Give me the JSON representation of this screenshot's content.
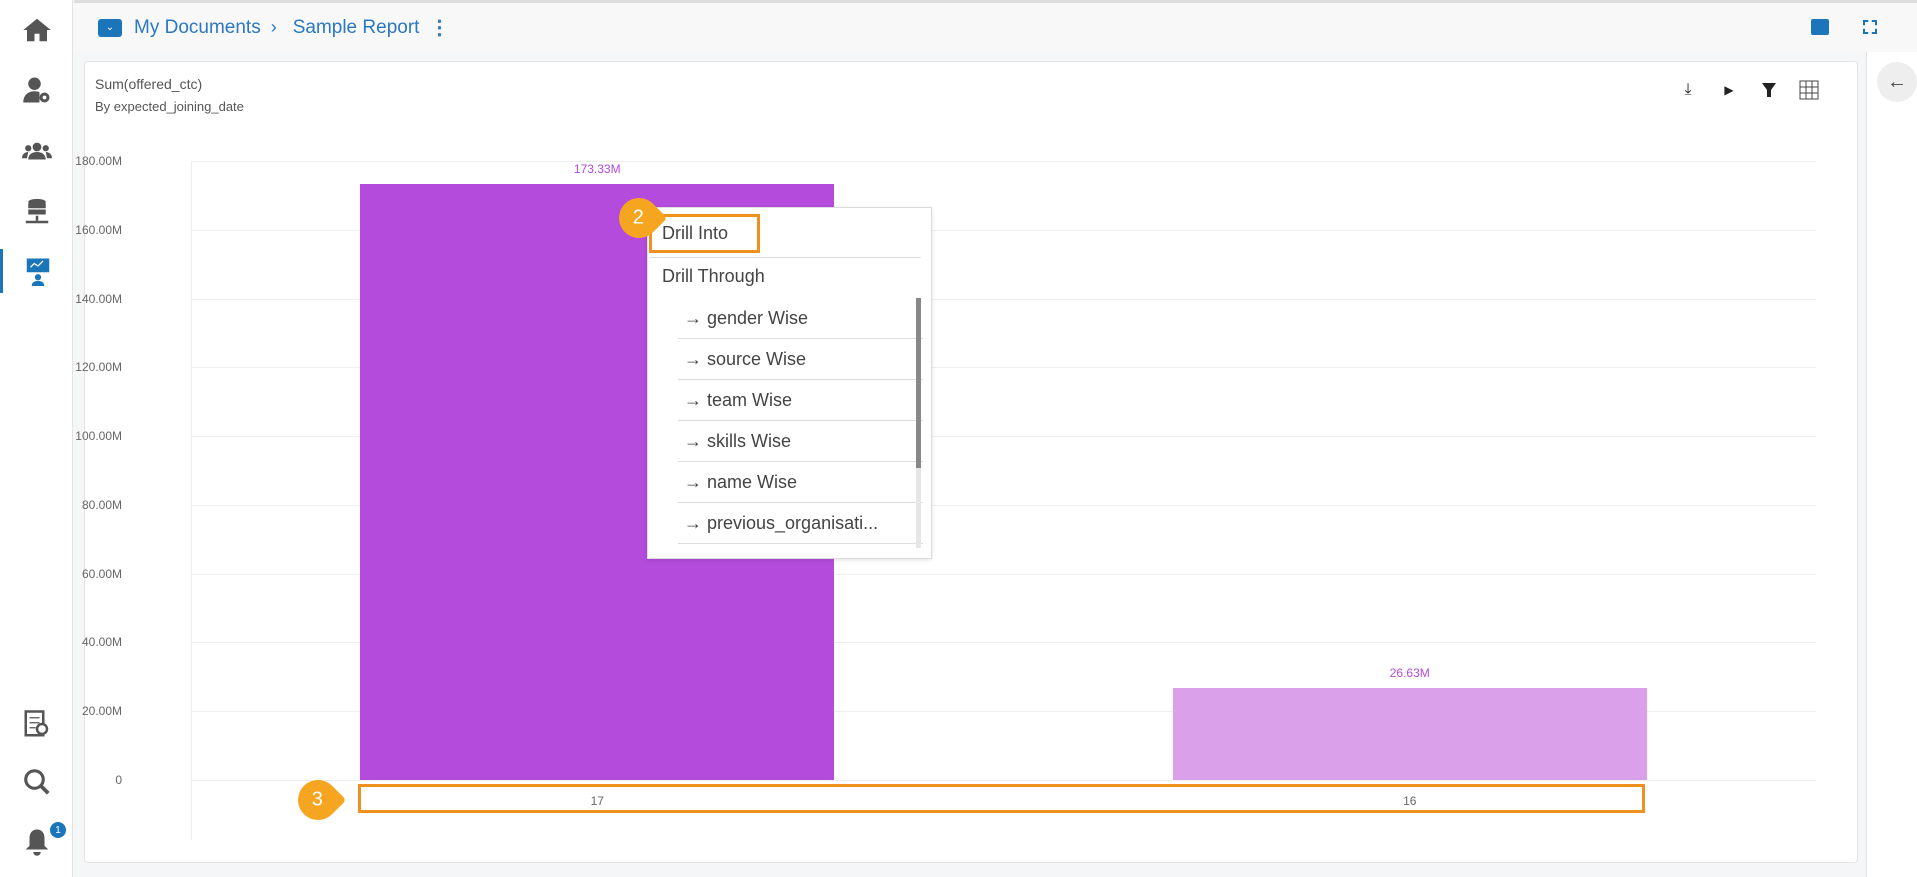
{
  "header": {
    "breadcrumb": [
      "My Documents",
      "Sample Report"
    ]
  },
  "chart_card": {
    "title": "Sum(offered_ctc)",
    "subtitle": "By expected_joining_date"
  },
  "notifications": {
    "count": "1"
  },
  "menu": {
    "drill_into": "Drill Into",
    "drill_through": "Drill Through",
    "items": [
      "→ gender Wise",
      "→ source Wise",
      "→ team Wise",
      "→ skills Wise",
      "→ name Wise",
      "→ previous_organisati..."
    ]
  },
  "annotations": {
    "menu_step": "2",
    "axis_step": "3"
  },
  "colors": {
    "bar_primary": "#b44bdc",
    "bar_secondary": "#dba0ea",
    "accent": "#1b75bb",
    "highlight": "#f0901e"
  },
  "chart_data": {
    "type": "bar",
    "title": "Sum(offered_ctc)",
    "subtitle": "By expected_joining_date",
    "categories": [
      "17",
      "16"
    ],
    "values": [
      173.33,
      26.63
    ],
    "value_labels": [
      "173.33M",
      "26.63M"
    ],
    "ylim": [
      0,
      180
    ],
    "yticks": [
      "0",
      "20.00M",
      "40.00M",
      "60.00M",
      "80.00M",
      "100.00M",
      "120.00M",
      "140.00M",
      "160.00M",
      "180.00M"
    ],
    "unit": "M",
    "grid": true
  }
}
